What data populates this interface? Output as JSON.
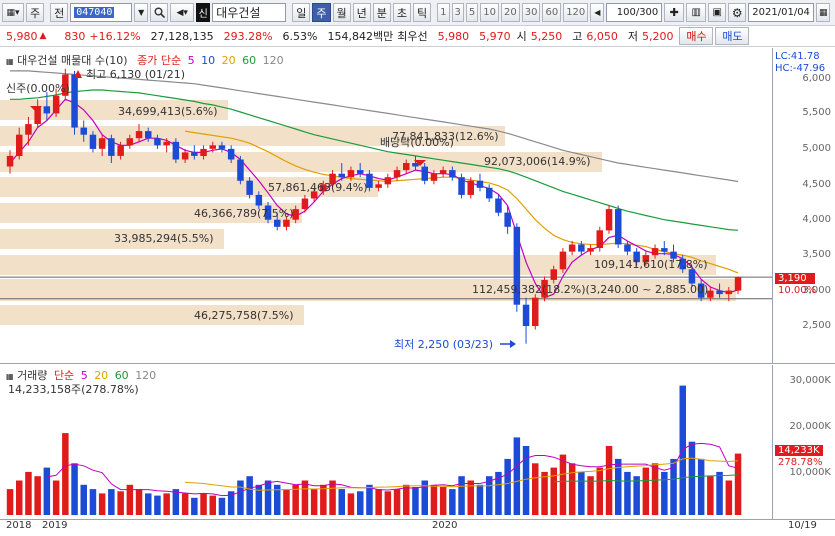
{
  "toolbar": {
    "period_left": "주",
    "jeon": "전",
    "code": "047040",
    "name_badge": "신",
    "stock_name": "대우건설",
    "tabs": [
      "일",
      "주",
      "월",
      "년",
      "분",
      "초",
      "틱"
    ],
    "active_tab": "주",
    "nums": [
      "1",
      "3",
      "5",
      "10",
      "20",
      "30",
      "60",
      "120"
    ],
    "count": "100/300",
    "date": "2021/01/04"
  },
  "quote": {
    "price": "5,980",
    "arrow": "▲",
    "change": "830",
    "rate": "+16.12%",
    "volume": "27,128,135",
    "vol_ratio": "293.28%",
    "turnover": "6.53%",
    "amount": "154,842백만",
    "best_ask_label": "최우선",
    "ask": "5,980",
    "bid": "5,970",
    "open_label": "시",
    "open": "5,250",
    "high_label": "고",
    "high": "6,050",
    "low_label": "저",
    "low": "5,200",
    "buy_label": "매수",
    "sell_label": "매도"
  },
  "price_pane": {
    "title": "대우건설 매물대 수(10)",
    "ma_label": "종가 단순",
    "ma_periods": [
      "5",
      "10",
      "20",
      "60",
      "120"
    ],
    "lc": "LC:41.78",
    "hc": "HC:-47.96",
    "ticks": [
      "6,000",
      "5,500",
      "5,000",
      "4,500",
      "4,000",
      "3,500",
      "3,000",
      "2,500"
    ],
    "cur_price": "3,190",
    "cur_pct": "10.00%",
    "max_label": "최고 6,130 (01/21)",
    "min_label": "최저 2,250 (03/23)",
    "dividend": "배당락(0.00%)",
    "top_left_ann": "신주(0.00%)",
    "profiles": [
      {
        "label": "34,699,413(5.6%)"
      },
      {
        "label": "77,841,833(12.6%)"
      },
      {
        "label": "92,073,006(14.9%)"
      },
      {
        "label": "57,861,463(9.4%)"
      },
      {
        "label": "46,366,789(7.5%)"
      },
      {
        "label": "33,985,294(5.5%)"
      },
      {
        "label": "109,141,610(17.8%)"
      },
      {
        "label": "112,459,382(18.2%)(3,240.00 ~ 2,885.00)"
      },
      {
        "label": "46,275,758(7.5%)"
      }
    ]
  },
  "volume_pane": {
    "title": "거래량",
    "ma_label": "단순",
    "ma_periods": [
      "5",
      "20",
      "60",
      "120"
    ],
    "value": "14,233,158주(278.78%)",
    "ticks": [
      "30,000K",
      "20,000K",
      "10,000K"
    ],
    "cur_vol": "14,233K",
    "cur_pct": "278.78%"
  },
  "x_axis": [
    "2018",
    "2019",
    "2020",
    "10/19"
  ],
  "chart_data": {
    "type": "candlestick",
    "title": "대우건설 매물대 수(10)",
    "ylim": [
      2250,
      6130
    ],
    "candles": [
      [
        4750,
        4980,
        4650,
        4900
      ],
      [
        4900,
        5300,
        4850,
        5200
      ],
      [
        5200,
        5450,
        5050,
        5350
      ],
      [
        5350,
        5700,
        5300,
        5600
      ],
      [
        5600,
        5800,
        5400,
        5500
      ],
      [
        5500,
        5850,
        5450,
        5750
      ],
      [
        5750,
        6130,
        5700,
        6050
      ],
      [
        6050,
        6100,
        5200,
        5300
      ],
      [
        5300,
        5400,
        5100,
        5200
      ],
      [
        5200,
        5250,
        4950,
        5000
      ],
      [
        5000,
        5200,
        4900,
        5150
      ],
      [
        5150,
        5200,
        4800,
        4900
      ],
      [
        4900,
        5100,
        4850,
        5050
      ],
      [
        5050,
        5200,
        5000,
        5150
      ],
      [
        5150,
        5350,
        5100,
        5250
      ],
      [
        5250,
        5300,
        5100,
        5150
      ],
      [
        5150,
        5200,
        5000,
        5050
      ],
      [
        5050,
        5150,
        4950,
        5100
      ],
      [
        5100,
        5150,
        4800,
        4850
      ],
      [
        4850,
        5000,
        4800,
        4950
      ],
      [
        4950,
        5050,
        4850,
        4900
      ],
      [
        4900,
        5050,
        4850,
        5000
      ],
      [
        5000,
        5100,
        4950,
        5050
      ],
      [
        5050,
        5100,
        4950,
        5000
      ],
      [
        5000,
        5050,
        4800,
        4850
      ],
      [
        4850,
        4900,
        4500,
        4550
      ],
      [
        4550,
        4600,
        4300,
        4350
      ],
      [
        4350,
        4400,
        4150,
        4200
      ],
      [
        4200,
        4250,
        3950,
        4000
      ],
      [
        4000,
        4100,
        3850,
        3900
      ],
      [
        3900,
        4050,
        3850,
        4000
      ],
      [
        4000,
        4200,
        3950,
        4150
      ],
      [
        4150,
        4350,
        4100,
        4300
      ],
      [
        4300,
        4450,
        4250,
        4400
      ],
      [
        4400,
        4550,
        4350,
        4500
      ],
      [
        4500,
        4700,
        4450,
        4650
      ],
      [
        4650,
        4800,
        4550,
        4600
      ],
      [
        4600,
        4750,
        4550,
        4700
      ],
      [
        4700,
        4800,
        4600,
        4650
      ],
      [
        4650,
        4700,
        4400,
        4450
      ],
      [
        4450,
        4550,
        4400,
        4500
      ],
      [
        4500,
        4650,
        4450,
        4600
      ],
      [
        4600,
        4750,
        4550,
        4700
      ],
      [
        4700,
        4850,
        4650,
        4800
      ],
      [
        4800,
        4900,
        4700,
        4750
      ],
      [
        4750,
        4800,
        4500,
        4550
      ],
      [
        4550,
        4700,
        4500,
        4650
      ],
      [
        4650,
        4750,
        4600,
        4700
      ],
      [
        4700,
        4750,
        4550,
        4600
      ],
      [
        4600,
        4650,
        4300,
        4350
      ],
      [
        4350,
        4600,
        4300,
        4550
      ],
      [
        4550,
        4650,
        4400,
        4450
      ],
      [
        4450,
        4500,
        4250,
        4300
      ],
      [
        4300,
        4350,
        4050,
        4100
      ],
      [
        4100,
        4200,
        3800,
        3900
      ],
      [
        3900,
        3950,
        2700,
        2800
      ],
      [
        2800,
        2900,
        2250,
        2500
      ],
      [
        2500,
        2950,
        2450,
        2900
      ],
      [
        2900,
        3200,
        2850,
        3150
      ],
      [
        3150,
        3350,
        3100,
        3300
      ],
      [
        3300,
        3600,
        3250,
        3550
      ],
      [
        3550,
        3700,
        3500,
        3650
      ],
      [
        3650,
        3700,
        3500,
        3550
      ],
      [
        3550,
        3650,
        3500,
        3600
      ],
      [
        3600,
        3900,
        3550,
        3850
      ],
      [
        3850,
        4200,
        3800,
        4150
      ],
      [
        4150,
        4200,
        3600,
        3650
      ],
      [
        3650,
        3700,
        3500,
        3550
      ],
      [
        3550,
        3600,
        3350,
        3400
      ],
      [
        3400,
        3550,
        3350,
        3500
      ],
      [
        3500,
        3650,
        3450,
        3600
      ],
      [
        3600,
        3700,
        3500,
        3550
      ],
      [
        3550,
        3650,
        3400,
        3450
      ],
      [
        3450,
        3500,
        3250,
        3300
      ],
      [
        3300,
        3350,
        3050,
        3100
      ],
      [
        3100,
        3150,
        2850,
        2900
      ],
      [
        2900,
        3050,
        2850,
        3000
      ],
      [
        3000,
        3100,
        2900,
        2950
      ],
      [
        2950,
        3050,
        2850,
        3000
      ],
      [
        3000,
        3200,
        2950,
        3190
      ]
    ],
    "ma5": [
      4800,
      4950,
      5100,
      5300,
      5400,
      5550,
      5700,
      5650,
      5550,
      5400,
      5200,
      5100,
      5050,
      5050,
      5100,
      5150,
      5150,
      5120,
      5050,
      4980,
      4950,
      4950,
      4980,
      5000,
      4950,
      4850,
      4700,
      4550,
      4380,
      4200,
      4080,
      4050,
      4120,
      4250,
      4400,
      4500,
      4580,
      4620,
      4650,
      4620,
      4580,
      4560,
      4600,
      4650,
      4700,
      4680,
      4650,
      4650,
      4640,
      4560,
      4520,
      4480,
      4440,
      4360,
      4200,
      3800,
      3400,
      3100,
      2900,
      2950,
      3200,
      3400,
      3500,
      3580,
      3620,
      3750,
      3780,
      3700,
      3630,
      3560,
      3520,
      3520,
      3510,
      3450,
      3330,
      3160,
      3050,
      3000,
      2970,
      3010
    ],
    "ma20": [
      null,
      null,
      null,
      null,
      null,
      null,
      null,
      null,
      null,
      null,
      null,
      null,
      null,
      null,
      null,
      null,
      null,
      null,
      null,
      5250,
      5230,
      5210,
      5190,
      5170,
      5150,
      5120,
      5080,
      5020,
      4960,
      4890,
      4820,
      4760,
      4710,
      4670,
      4640,
      4620,
      4600,
      4580,
      4570,
      4560,
      4550,
      4540,
      4550,
      4560,
      4570,
      4580,
      4590,
      4600,
      4600,
      4580,
      4560,
      4540,
      4520,
      4480,
      4420,
      4300,
      4150,
      4000,
      3880,
      3780,
      3720,
      3680,
      3660,
      3650,
      3650,
      3660,
      3670,
      3660,
      3640,
      3620,
      3580,
      3550,
      3520,
      3500,
      3470,
      3420,
      3380,
      3340,
      3300,
      3250
    ],
    "ma60": [
      5700,
      5700,
      5710,
      5720,
      5740,
      5760,
      5790,
      5810,
      5820,
      5830,
      5830,
      5820,
      5810,
      5800,
      5790,
      5770,
      5750,
      5730,
      5710,
      5690,
      5670,
      5640,
      5620,
      5590,
      5560,
      5520,
      5480,
      5440,
      5400,
      5360,
      5320,
      5280,
      5240,
      5200,
      5170,
      5140,
      5110,
      5080,
      5050,
      5020,
      4990,
      4960,
      4940,
      4920,
      4900,
      4880,
      4860,
      4840,
      4820,
      4800,
      4780,
      4760,
      4740,
      4720,
      4690,
      4650,
      4600,
      4550,
      4500,
      4450,
      4400,
      4360,
      4320,
      4280,
      4240,
      4200,
      4160,
      4120,
      4090,
      4060,
      4030,
      4000,
      3980,
      3960,
      3940,
      3920,
      3900,
      3880,
      3860,
      3850
    ],
    "ma120": [
      6100,
      6100,
      6100,
      6090,
      6080,
      6070,
      6060,
      6050,
      6040,
      6030,
      6020,
      6010,
      6000,
      5990,
      5980,
      5970,
      5960,
      5950,
      5940,
      5930,
      5920,
      5900,
      5880,
      5860,
      5840,
      5820,
      5800,
      5780,
      5760,
      5740,
      5720,
      5700,
      5680,
      5660,
      5640,
      5620,
      5600,
      5580,
      5560,
      5540,
      5520,
      5500,
      5480,
      5460,
      5440,
      5420,
      5400,
      5380,
      5360,
      5340,
      5320,
      5300,
      5280,
      5250,
      5220,
      5180,
      5140,
      5100,
      5060,
      5020,
      4980,
      4950,
      4920,
      4890,
      4860,
      4830,
      4800,
      4780,
      4760,
      4740,
      4720,
      4700,
      4680,
      4660,
      4640,
      4620,
      4600,
      4580,
      4560,
      4540
    ],
    "volume_k": [
      6000,
      8000,
      10000,
      9000,
      11000,
      8000,
      19000,
      12000,
      7000,
      6000,
      5000,
      6000,
      5500,
      7000,
      6000,
      5000,
      4500,
      5000,
      6000,
      5000,
      4000,
      5000,
      4500,
      4000,
      5500,
      8000,
      9000,
      7000,
      8000,
      7000,
      6000,
      7000,
      8000,
      6000,
      7000,
      8000,
      6000,
      5000,
      5500,
      7000,
      6000,
      5500,
      6000,
      7000,
      6500,
      8000,
      7000,
      6500,
      6000,
      9000,
      8000,
      7000,
      9000,
      10000,
      13000,
      18000,
      16000,
      12000,
      10000,
      11000,
      14000,
      12000,
      10000,
      9000,
      11000,
      16000,
      13000,
      10000,
      9000,
      11000,
      12000,
      10000,
      13000,
      30000,
      17000,
      13000,
      9000,
      10000,
      8000,
      14233
    ]
  }
}
